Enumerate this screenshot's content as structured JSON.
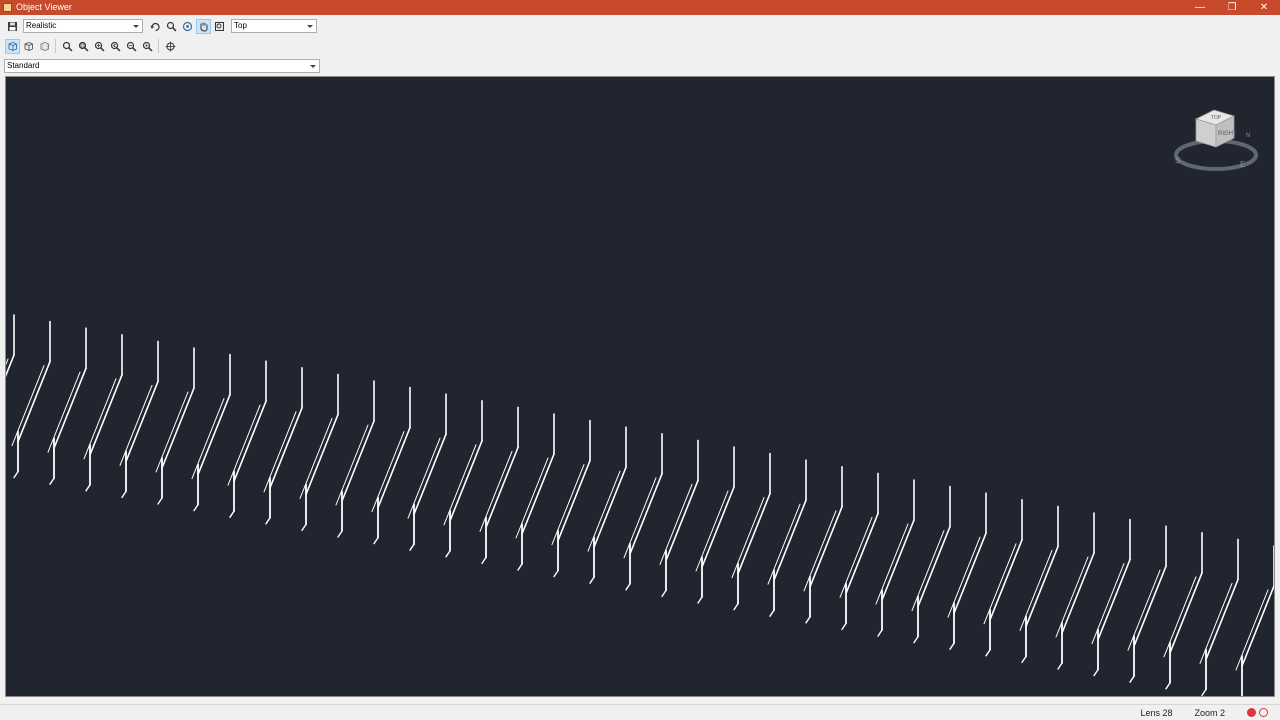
{
  "window": {
    "title": "Object Viewer",
    "controls": [
      "—",
      "❐",
      "✕"
    ]
  },
  "toolbar": {
    "visual_style": "Realistic",
    "view": "Top",
    "ucs": "Standard"
  },
  "status": {
    "lens": "Lens 28",
    "zoom": "Zoom 2"
  },
  "viewcube": {
    "face_labels": [
      "TOP",
      "RIGHT"
    ],
    "compass": [
      "S",
      "N",
      "E"
    ]
  },
  "colors": {
    "titlebar": "#c84a2c",
    "viewport_bg": "#212530",
    "model_lines": "#ffffff",
    "status_red": "#d9363e"
  }
}
